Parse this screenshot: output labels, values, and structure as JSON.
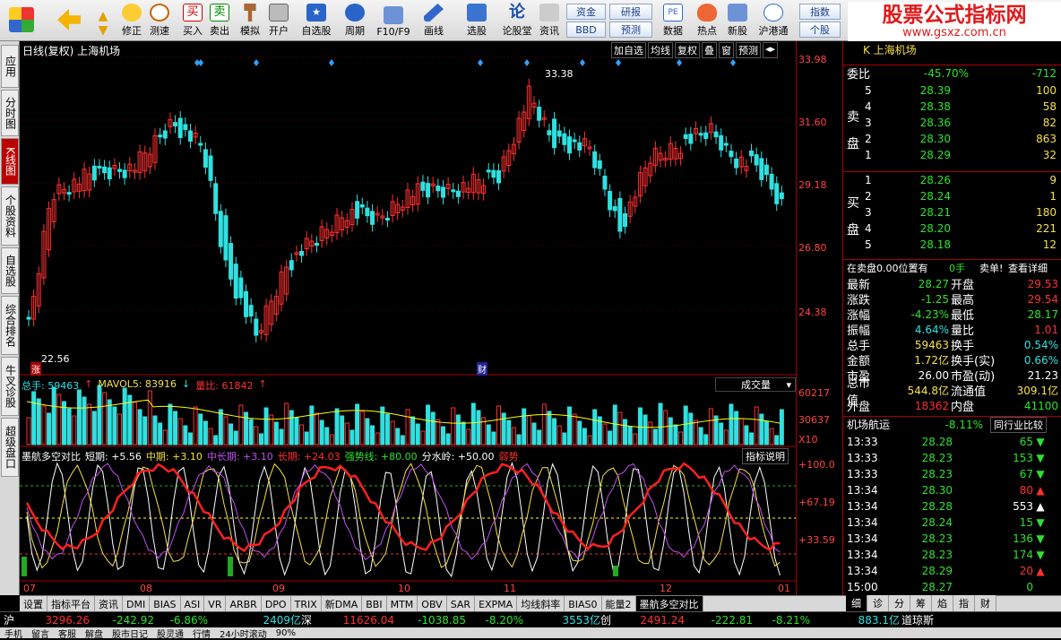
{
  "toolbar": {
    "buttons": [
      "修正",
      "测速",
      "买入",
      "卖出",
      "模拟",
      "开户",
      "自选股",
      "周期",
      "F10/F9",
      "画线",
      "选股",
      "论股堂",
      "资讯",
      "数据",
      "热点",
      "新股",
      "沪港通"
    ],
    "small": [
      "资金",
      "研报",
      "指数",
      "BBD",
      "预测",
      "个股"
    ]
  },
  "watermark": {
    "title": "股票公式指标网",
    "url": "www.gsxz.com.cn"
  },
  "left_tabs": [
    "应用",
    "分时图",
    "K线图",
    "个股资料",
    "自选股",
    "综合排名",
    "牛叉诊股",
    "超级盘口"
  ],
  "chart": {
    "header": "日线(复权) 上海机场",
    "buttons": [
      "加自选",
      "均线",
      "复权",
      "叠",
      "窗",
      "预测"
    ],
    "max_label": "33.38",
    "min_label": "22.56",
    "vol_header": {
      "a": "总手: 59463",
      "b": "MAVOL5: 83916",
      "c": "量比: 61842"
    },
    "vol_select": "成交量",
    "ind_header": {
      "name": "墨航多空对比",
      "short": "短期: +5.56",
      "mid": "中期: +3.10",
      "midlong": "中长期: +3.10",
      "long": "长期: +24.03",
      "strong": "强势线: +80.00",
      "water": "分水岭: +50.00",
      "weak": "弱势"
    },
    "ind_btn": "指标说明",
    "months": [
      "07",
      "08",
      "09",
      "10",
      "11",
      "12",
      "01"
    ],
    "mark_zhang": "涨",
    "mark_cai": "财"
  },
  "axis": {
    "price": [
      "33.98",
      "31.60",
      "29.18",
      "26.80",
      "24.38"
    ],
    "vol": [
      "60217",
      "30637",
      "X10"
    ],
    "ind": [
      "+100.0",
      "+67.19",
      "+33.59"
    ]
  },
  "quote": {
    "title": "K 上海机场",
    "weibi": {
      "label": "委比",
      "pct": "-45.70%",
      "val": "-712"
    },
    "sell": [
      [
        "5",
        "28.39",
        "100"
      ],
      [
        "4",
        "28.38",
        "58"
      ],
      [
        "3",
        "28.36",
        "82"
      ],
      [
        "2",
        "28.30",
        "863"
      ],
      [
        "1",
        "28.29",
        "32"
      ]
    ],
    "buy": [
      [
        "1",
        "28.26",
        "9"
      ],
      [
        "2",
        "28.24",
        "1"
      ],
      [
        "3",
        "28.21",
        "180"
      ],
      [
        "4",
        "28.20",
        "221"
      ],
      [
        "5",
        "28.18",
        "12"
      ]
    ],
    "sell_side": [
      "卖",
      "盘"
    ],
    "buy_side": [
      "买",
      "盘"
    ],
    "notice": {
      "a": "在卖盘0.00位置有",
      "b": "0手",
      "c": "卖单!",
      "d": "查看详细"
    },
    "stats": [
      [
        "最新",
        "28.27",
        "开盘",
        "29.53"
      ],
      [
        "涨跌",
        "-1.25",
        "最高",
        "29.54"
      ],
      [
        "涨幅",
        "-4.23%",
        "最低",
        "28.17"
      ],
      [
        "振幅",
        "4.64%",
        "量比",
        "1.01"
      ],
      [
        "总手",
        "59463",
        "换手",
        "0.54%"
      ],
      [
        "金额",
        "1.72亿",
        "换手(实)",
        "0.66%"
      ],
      [
        "市盈",
        "26.00",
        "市盈(动)",
        "21.23"
      ],
      [
        "总市值",
        "544.8亿",
        "流通值",
        "309.1亿"
      ],
      [
        "外盘",
        "18362",
        "内盘",
        "41100"
      ]
    ],
    "sector": {
      "name": "机场航运",
      "pct": "-8.11%",
      "btn": "同行业比较"
    },
    "ticks": [
      [
        "13:33",
        "28.28",
        "65"
      ],
      [
        "13:33",
        "28.23",
        "153"
      ],
      [
        "13:33",
        "28.23",
        "67"
      ],
      [
        "13:34",
        "28.30",
        "80"
      ],
      [
        "13:34",
        "28.28",
        "553"
      ],
      [
        "13:34",
        "28.24",
        "15"
      ],
      [
        "13:34",
        "28.23",
        "136"
      ],
      [
        "13:34",
        "28.23",
        "174"
      ],
      [
        "13:34",
        "28.29",
        "20"
      ],
      [
        "15:00",
        "28.27",
        "0"
      ]
    ],
    "tick_dirs": [
      "down",
      "down",
      "down",
      "up",
      "up",
      "down",
      "down",
      "down",
      "up",
      "none"
    ],
    "sub_tabs": [
      "细",
      "诊",
      "分",
      "筹",
      "焰",
      "指",
      "财"
    ]
  },
  "bottom_tabs": [
    "设置",
    "指标平台",
    "资讯",
    "DMI",
    "BIAS",
    "ASI",
    "VR",
    "ARBR",
    "DPO",
    "TRIX",
    "新DMA",
    "BBI",
    "MTM",
    "OBV",
    "SAR",
    "EXPMA",
    "均线斜率",
    "BIAS0",
    "能量2",
    "墨航多空对比"
  ],
  "status": {
    "sh": {
      "label": "沪",
      "a": "3296.26",
      "b": "-242.92",
      "c": "-6.86%",
      "d": "2409亿"
    },
    "sz": {
      "label": "深",
      "a": "11626.04",
      "b": "-1038.85",
      "c": "-8.20%",
      "d": "3553亿"
    },
    "cy": {
      "label": "创",
      "a": "2491.24",
      "b": "-222.81",
      "c": "-8.21%",
      "d": "883.1亿"
    },
    "dj": {
      "label": "道琼斯"
    }
  },
  "status2": [
    "手机",
    "留言",
    "客服",
    "解盘",
    "股市日记",
    "股灵通",
    "行情",
    "24小时滚动",
    "90%"
  ],
  "colors": {
    "up": "#ff3030",
    "down": "#30e0e0",
    "bg": "#000000"
  }
}
